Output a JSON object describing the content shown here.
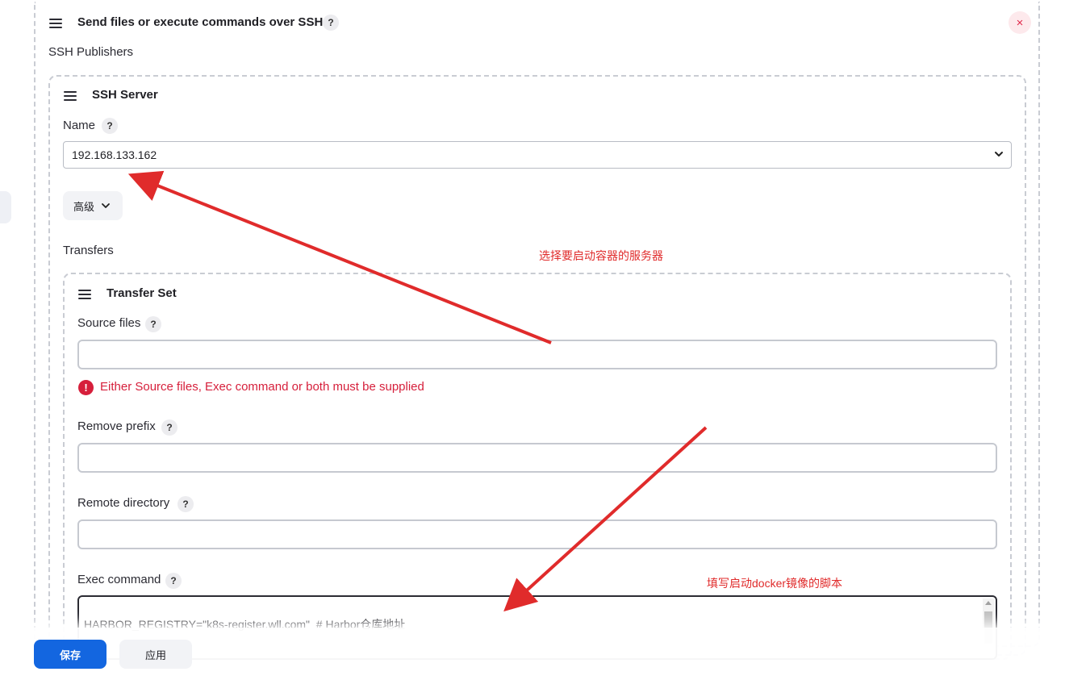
{
  "section": {
    "title": "Send files or execute commands over SSH",
    "help": "?",
    "close": "×",
    "publishers_label": "SSH Publishers"
  },
  "server": {
    "title": "SSH Server",
    "name_label": "Name",
    "name_value": "192.168.133.162",
    "advanced_label": "高级",
    "transfers_label": "Transfers"
  },
  "transfer_set": {
    "title": "Transfer Set",
    "source_files_label": "Source files",
    "source_files_value": "",
    "error_text": "Either Source files, Exec command or both must be supplied",
    "error_icon": "!",
    "remove_prefix_label": "Remove prefix",
    "remove_prefix_value": "",
    "remote_directory_label": "Remote directory",
    "remote_directory_value": "",
    "exec_command_label": "Exec command",
    "exec_command_value": "HARBOR_REGISTRY=\"k8s-register.wll.com\"  # Harbor仓库地址"
  },
  "annotations": {
    "server_note": "选择要启动容器的服务器",
    "exec_note": "填写启动docker镜像的脚本"
  },
  "footer": {
    "save_label": "保存",
    "apply_label": "应用"
  },
  "colors": {
    "primary": "#1366e0",
    "error": "#d61f3b",
    "annotation": "#e02b2b"
  }
}
